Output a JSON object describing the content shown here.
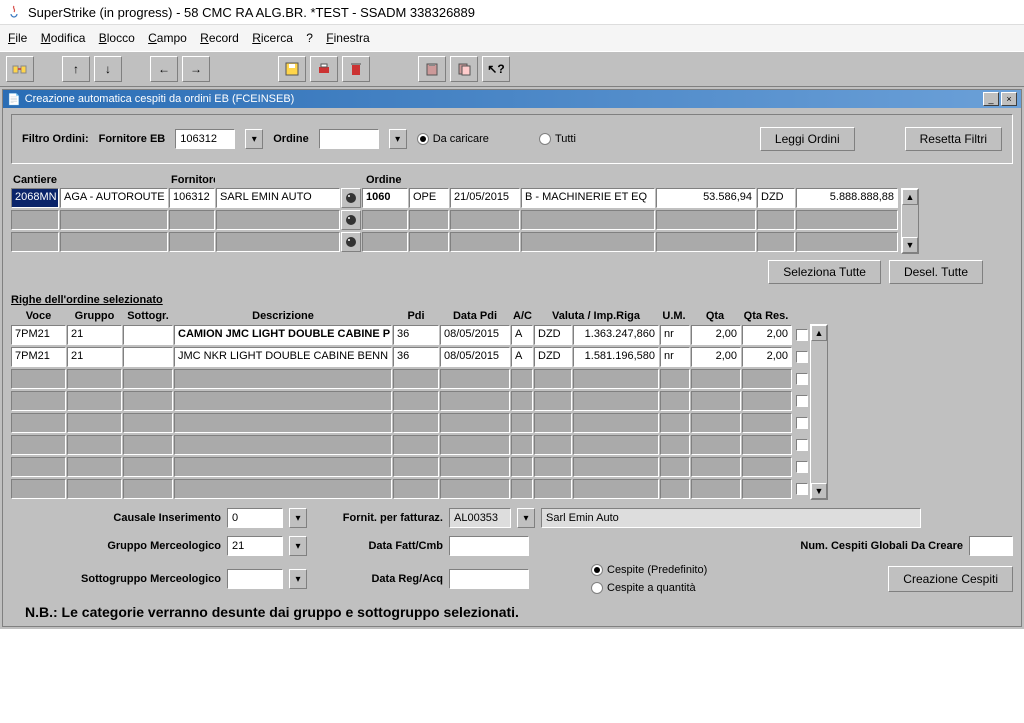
{
  "window": {
    "title": "SuperStrike (in progress) - 58 CMC RA ALG.BR. *TEST - SSADM 338326889"
  },
  "menu": {
    "file": "File",
    "modifica": "Modifica",
    "blocco": "Blocco",
    "campo": "Campo",
    "record": "Record",
    "ricerca": "Ricerca",
    "q": "?",
    "finestra": "Finestra"
  },
  "child": {
    "title": "Creazione automatica cespiti da ordini EB (FCEINSEB)"
  },
  "filter": {
    "filtro_label": "Filtro Ordini:",
    "fornitore_label": "Fornitore EB",
    "fornitore_val": "106312",
    "ordine_label": "Ordine",
    "ordine_val": "",
    "radio_dacaricare": "Da caricare",
    "radio_tutti": "Tutti",
    "btn_leggi": "Leggi Ordini",
    "btn_resetta": "Resetta Filtri"
  },
  "ordini_headers": {
    "cantiere": "Cantiere",
    "fornitore": "Fornitore EB",
    "ordine": "Ordine"
  },
  "ordini_row": {
    "cantiere_code": "2068MN",
    "cantiere_desc": "AGA - AUTOROUTE",
    "forn_code": "106312",
    "forn_desc": "SARL EMIN AUTO",
    "ord_num": "1060",
    "ord_tipo": "OPE",
    "ord_data": "21/05/2015",
    "ord_cat": "B - MACHINERIE ET EQ",
    "ord_imp": "53.586,94",
    "ord_val": "DZD",
    "ord_tot": "5.888.888,88"
  },
  "actions": {
    "seleziona": "Seleziona Tutte",
    "deseleziona": "Desel. Tutte"
  },
  "righe": {
    "title": "Righe dell'ordine selezionato",
    "h": {
      "voce": "Voce",
      "gruppo": "Gruppo",
      "sottogr": "Sottogr.",
      "descr": "Descrizione",
      "pdi": "Pdi",
      "data_pdi": "Data Pdi",
      "ac": "A/C",
      "valuta": "Valuta / Imp.Riga",
      "um": "U.M.",
      "qta": "Qta",
      "qtares": "Qta Res."
    },
    "rows": [
      {
        "voce": "7PM21",
        "gruppo": "21",
        "sottogr": "",
        "descr": "CAMION JMC LIGHT DOUBLE CABINE P",
        "pdi": "36",
        "data_pdi": "08/05/2015",
        "ac": "A",
        "valuta": "DZD",
        "imp": "1.363.247,860",
        "um": "nr",
        "qta": "2,00",
        "qtares": "2,00"
      },
      {
        "voce": "7PM21",
        "gruppo": "21",
        "sottogr": "",
        "descr": "JMC NKR LIGHT DOUBLE CABINE BENN",
        "pdi": "36",
        "data_pdi": "08/05/2015",
        "ac": "A",
        "valuta": "DZD",
        "imp": "1.581.196,580",
        "um": "nr",
        "qta": "2,00",
        "qtares": "2,00"
      }
    ]
  },
  "form": {
    "causale_lbl": "Causale Inserimento",
    "causale_val": "0",
    "fornit_lbl": "Fornit. per fatturaz.",
    "fornit_val": "AL00353",
    "fornit_desc": "Sarl Emin Auto",
    "gruppo_lbl": "Gruppo Merceologico",
    "gruppo_val": "21",
    "datafatt_lbl": "Data Fatt/Cmb",
    "datafatt_val": "",
    "numcespiti_lbl": "Num. Cespiti Globali Da Creare",
    "numcespiti_val": "",
    "sottogr_lbl": "Sottogruppo Merceologico",
    "sottogr_val": "",
    "datareg_lbl": "Data Reg/Acq",
    "datareg_val": "",
    "r_predef": "Cespite (Predefinito)",
    "r_quant": "Cespite a quantità",
    "btn_crea": "Creazione Cespiti"
  },
  "note": "N.B.: Le categorie verranno desunte dai gruppo e sottogruppo selezionati."
}
